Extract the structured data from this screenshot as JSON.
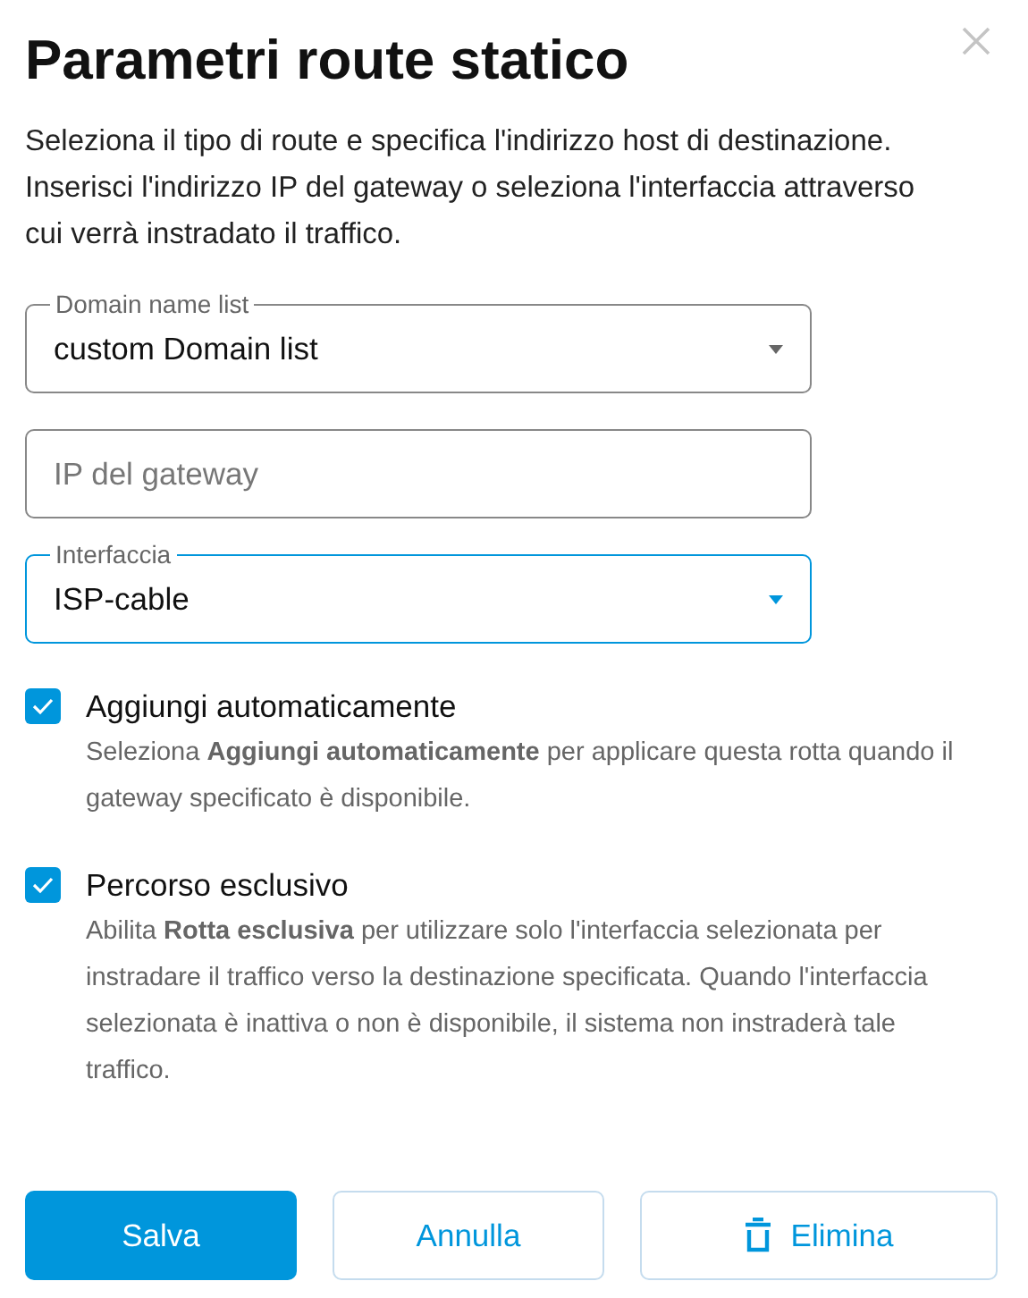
{
  "title": "Parametri route statico",
  "description": "Seleziona il tipo di route e specifica l'indirizzo host di destinazione. Inserisci l'indirizzo IP del gateway o seleziona l'interfaccia attraverso cui verrà instradato il traffico.",
  "fields": [
    {
      "kind": "select",
      "label": "Domain name list",
      "value": "custom Domain list",
      "focused": false
    },
    {
      "kind": "input",
      "placeholder": "IP del gateway",
      "focused": false
    },
    {
      "kind": "select",
      "label": "Interfaccia",
      "value": "ISP-cable",
      "focused": true
    }
  ],
  "options": [
    {
      "label": "Aggiungi automaticamente",
      "checked": true,
      "help": "Seleziona **Aggiungi automaticamente** per applicare questa rotta quando il gateway specificato è disponibile."
    },
    {
      "label": "Percorso esclusivo",
      "checked": true,
      "help": "Abilita **Rotta esclusiva** per utilizzare solo l'interfaccia selezionata per instradare il traffico verso la destinazione specificata. Quando l'interfaccia selezionata è inattiva o non è disponibile, il sistema non instraderà tale traffico."
    }
  ],
  "buttons": [
    {
      "kind": "primary",
      "label": "Salva"
    },
    {
      "kind": "secondary",
      "label": "Annulla"
    },
    {
      "kind": "delete",
      "label": "Elimina"
    }
  ]
}
